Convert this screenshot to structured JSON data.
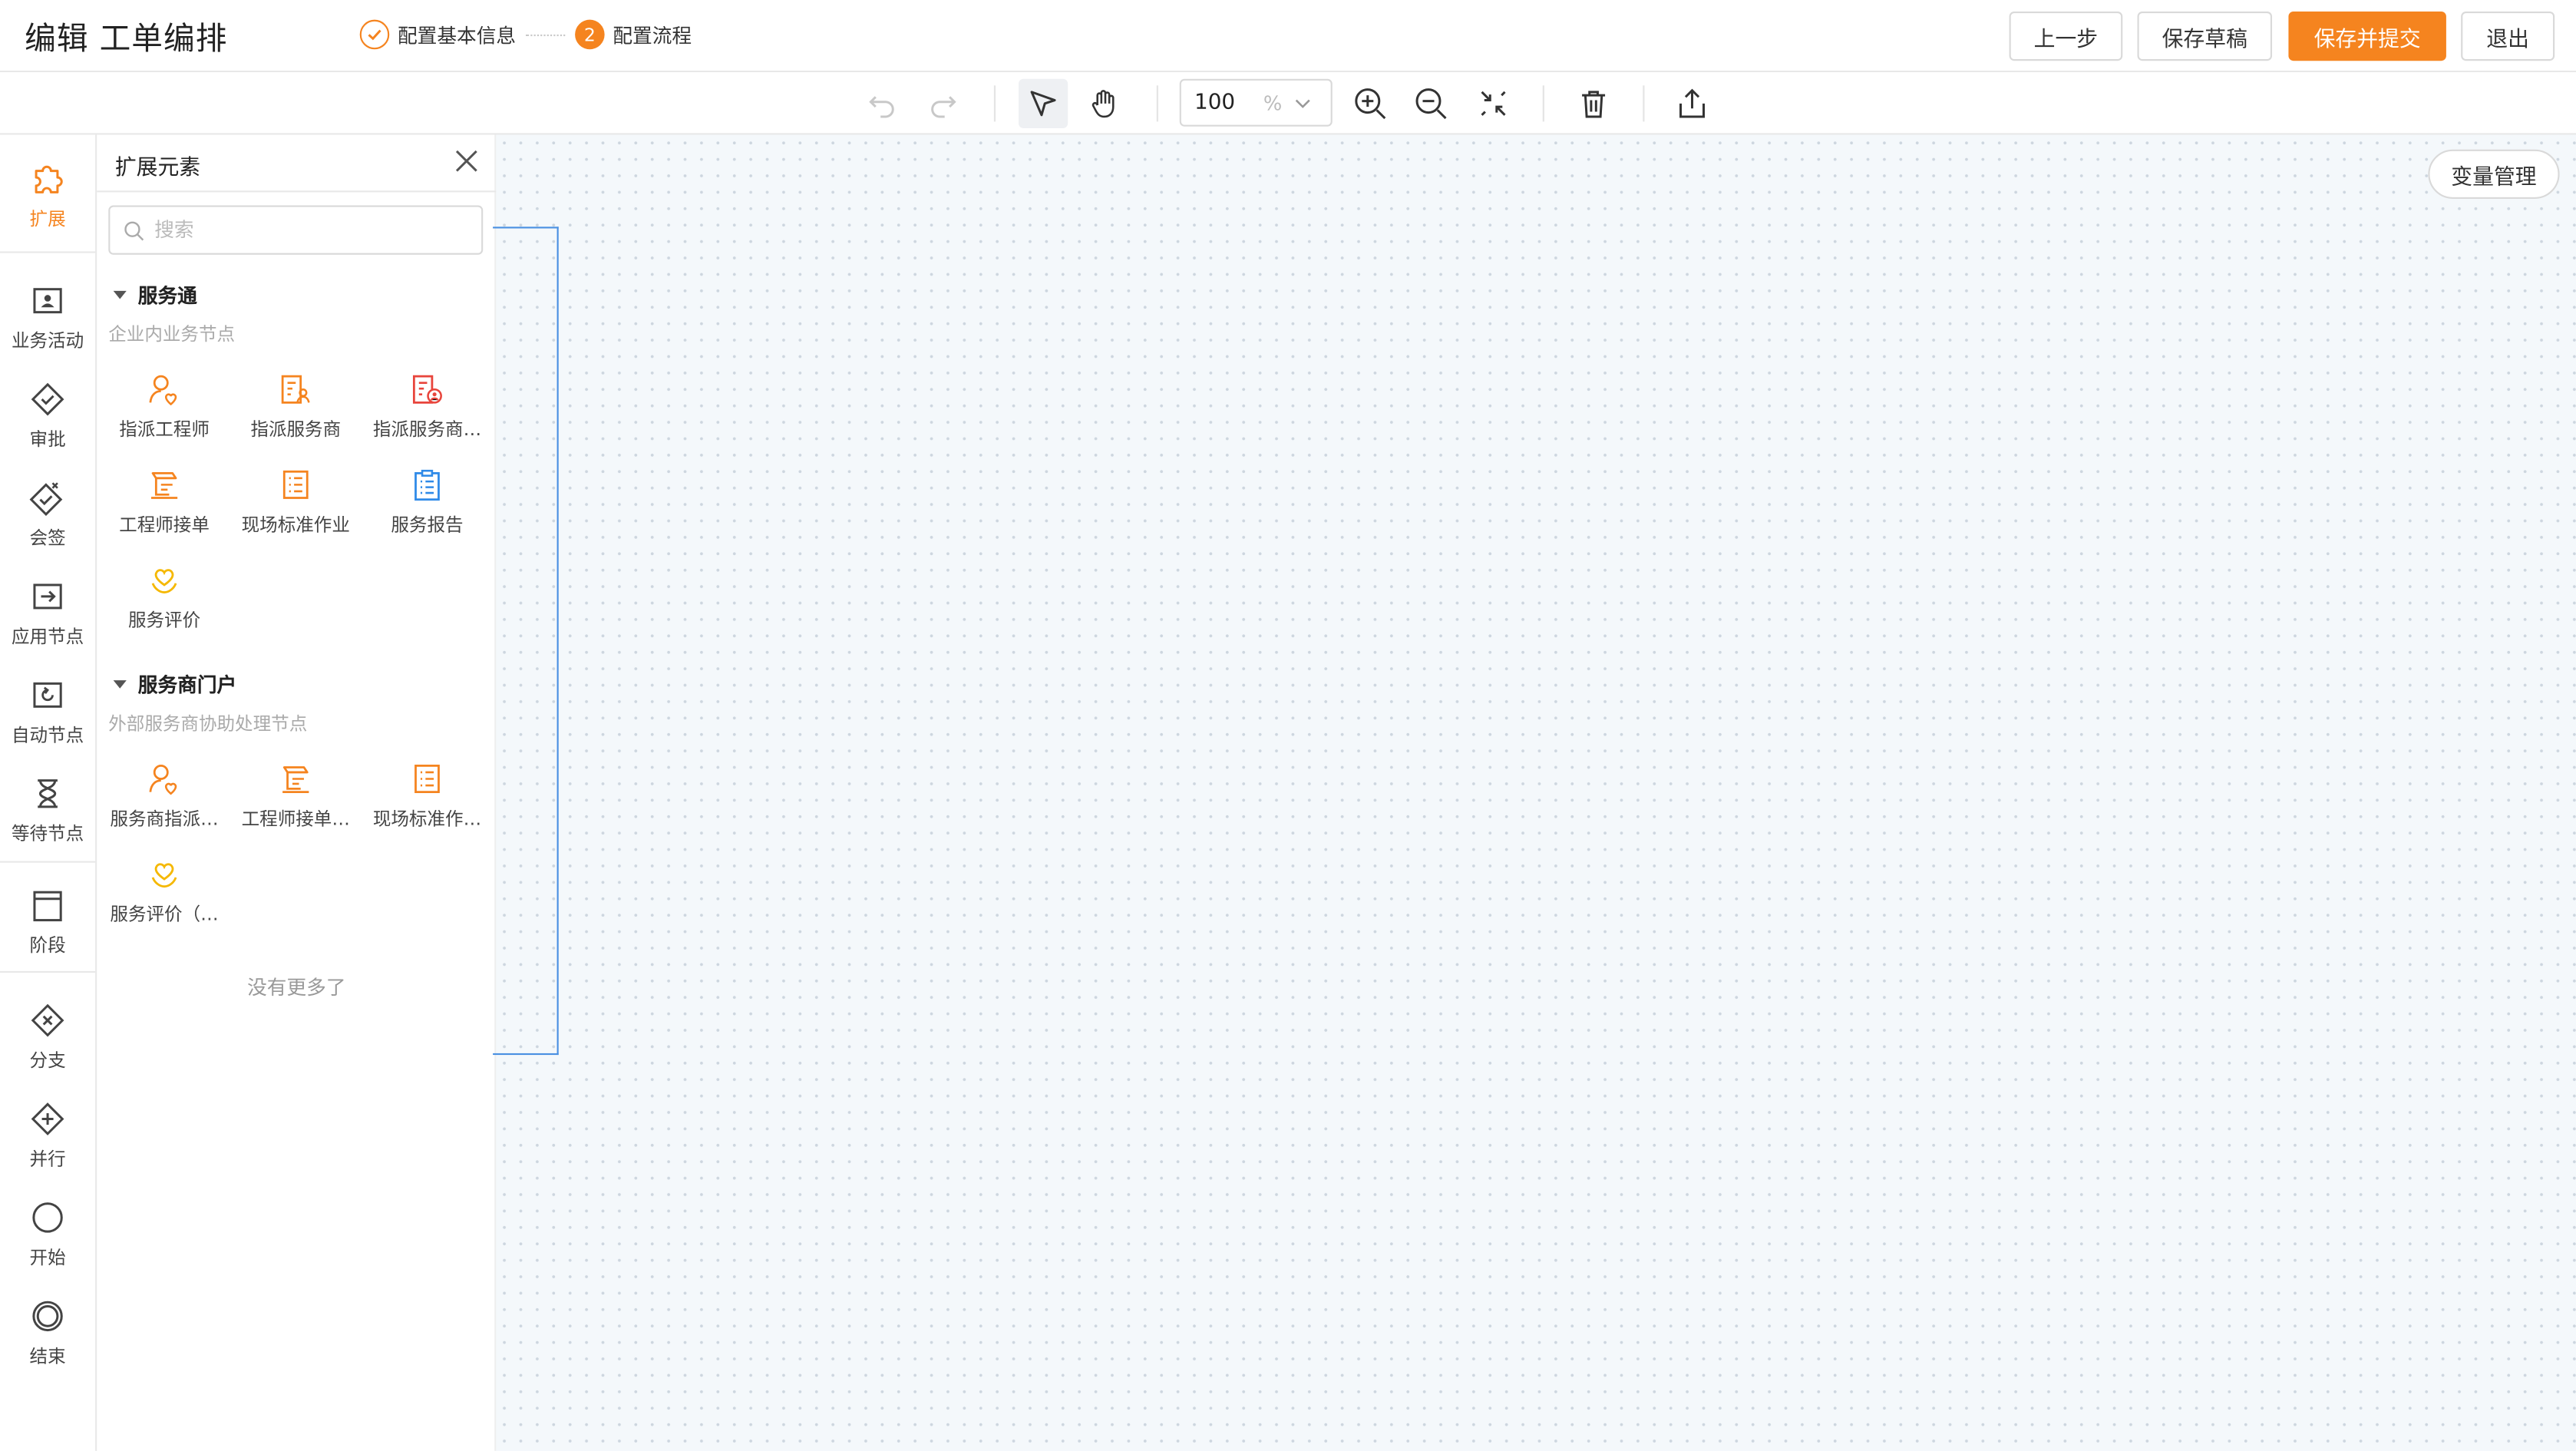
{
  "header": {
    "title": "编辑 工单编排",
    "steps": [
      {
        "label": "配置基本信息",
        "status": "done"
      },
      {
        "number": "2",
        "label": "配置流程",
        "status": "current"
      }
    ],
    "buttons": {
      "prev": "上一步",
      "save_draft": "保存草稿",
      "save_submit": "保存并提交",
      "exit": "退出"
    },
    "accent_color": "#f5841f"
  },
  "toolbar": {
    "zoom_value": "100",
    "zoom_unit": "%",
    "icons": [
      "undo-icon",
      "redo-icon",
      "pointer-icon",
      "hand-icon",
      "zoom-in-icon",
      "zoom-out-icon",
      "fit-icon",
      "delete-icon",
      "export-icon"
    ]
  },
  "rail": {
    "items": [
      {
        "label": "扩展",
        "icon": "puzzle-icon",
        "active": true
      },
      {
        "label": "业务活动",
        "icon": "activity-icon"
      },
      {
        "label": "审批",
        "icon": "approval-icon"
      },
      {
        "label": "会签",
        "icon": "countersign-icon"
      },
      {
        "label": "应用节点",
        "icon": "app-node-icon"
      },
      {
        "label": "自动节点",
        "icon": "auto-node-icon"
      },
      {
        "label": "等待节点",
        "icon": "hourglass-icon"
      },
      {
        "label": "阶段",
        "icon": "stage-icon"
      },
      {
        "label": "分支",
        "icon": "branch-icon"
      },
      {
        "label": "并行",
        "icon": "parallel-icon"
      },
      {
        "label": "开始",
        "icon": "start-icon"
      },
      {
        "label": "结束",
        "icon": "end-icon"
      }
    ]
  },
  "panel": {
    "title": "扩展元素",
    "search_placeholder": "搜索",
    "groups": [
      {
        "title": "服务通",
        "subtitle": "企业内业务节点",
        "nodes": [
          {
            "label": "指派工程师",
            "icon": "assign-engineer-icon"
          },
          {
            "label": "指派服务商",
            "icon": "assign-provider-icon"
          },
          {
            "label": "指派服务商…",
            "icon": "assign-provider-red-icon"
          },
          {
            "label": "工程师接单",
            "icon": "engineer-accept-icon"
          },
          {
            "label": "现场标准作业",
            "icon": "onsite-sop-icon"
          },
          {
            "label": "服务报告",
            "icon": "service-report-icon"
          },
          {
            "label": "服务评价",
            "icon": "service-rating-icon"
          }
        ]
      },
      {
        "title": "服务商门户",
        "subtitle": "外部服务商协助处理节点",
        "nodes": [
          {
            "label": "服务商指派…",
            "icon": "provider-assign-icon"
          },
          {
            "label": "工程师接单…",
            "icon": "engineer-accept-icon"
          },
          {
            "label": "现场标准作…",
            "icon": "onsite-sop-icon"
          },
          {
            "label": "服务评价（…",
            "icon": "service-rating-icon"
          }
        ]
      }
    ],
    "no_more": "没有更多了"
  },
  "canvas": {
    "variable_button": "变量管理",
    "selection_color": "#4a90e2"
  }
}
